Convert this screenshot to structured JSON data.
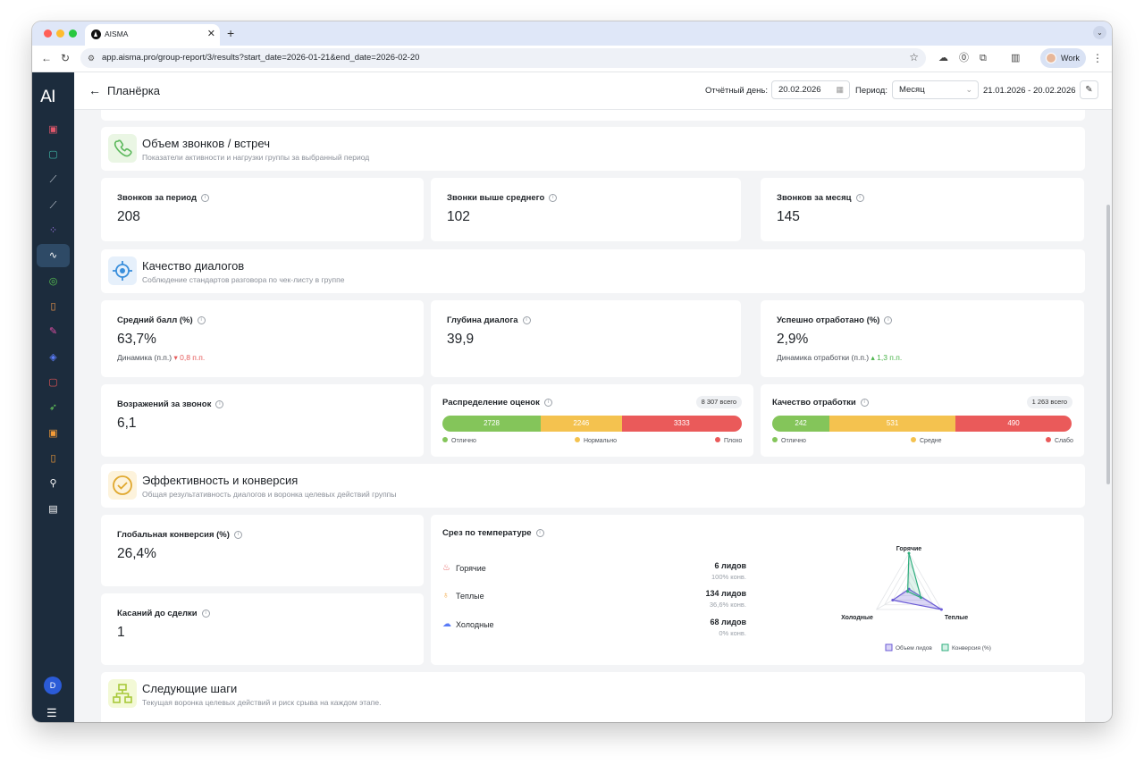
{
  "browser": {
    "tab_title": "AISMA",
    "url": "app.aisma.pro/group-report/3/results?start_date=2026-01-21&end_date=2026-02-20",
    "profile_label": "Work"
  },
  "sidebar": {
    "logo": "AI",
    "user_initial": "D",
    "items": [
      {
        "icon": "report-icon",
        "color": "#e0576b"
      },
      {
        "icon": "chat-icon",
        "color": "#3fb7a6"
      },
      {
        "icon": "line-chart-icon",
        "color": "#c9d1da"
      },
      {
        "icon": "trend-icon",
        "color": "#c9d1da"
      },
      {
        "icon": "apps-icon",
        "color": "#a57cf0"
      },
      {
        "icon": "activity-icon",
        "color": "#ffffff",
        "active": true
      },
      {
        "icon": "target-icon",
        "color": "#57c24f"
      },
      {
        "icon": "clipboard-icon",
        "color": "#f2994a"
      },
      {
        "icon": "edit-icon",
        "color": "#e04fa5"
      },
      {
        "icon": "layers-icon",
        "color": "#5b7cf7"
      },
      {
        "icon": "alert-icon",
        "color": "#e25555"
      },
      {
        "icon": "rocket-icon",
        "color": "#63c75a"
      },
      {
        "icon": "contact-icon",
        "color": "#f29b38"
      },
      {
        "icon": "clipboard-check-icon",
        "color": "#f29b38"
      },
      {
        "icon": "link-icon",
        "color": "#ffffff"
      },
      {
        "icon": "book-icon",
        "color": "#ffffff"
      }
    ]
  },
  "header": {
    "title": "Планёрка",
    "report_day_label": "Отчётный день:",
    "report_day_value": "20.02.2026",
    "period_label": "Период:",
    "period_value": "Месяц",
    "date_range": "21.01.2026 - 20.02.2026"
  },
  "sections": {
    "calls": {
      "title": "Объем звонков / встреч",
      "subtitle": "Показатели активности и нагрузки группы за выбранный период"
    },
    "quality": {
      "title": "Качество диалогов",
      "subtitle": "Соблюдение стандартов разговора по чек-листу в группе"
    },
    "efficiency": {
      "title": "Эффективность и конверсия",
      "subtitle": "Общая результативность диалогов и воронка целевых действий группы"
    },
    "next_steps": {
      "title": "Следующие шаги",
      "subtitle": "Текущая воронка целевых действий и риск срыва на каждом этапе."
    }
  },
  "metrics": {
    "calls_period": {
      "label": "Звонков за период",
      "value": "208"
    },
    "calls_above_avg": {
      "label": "Звонки выше среднего",
      "value": "102"
    },
    "calls_month": {
      "label": "Звонков за месяц",
      "value": "145"
    },
    "avg_score": {
      "label": "Средний балл (%)",
      "value": "63,7%",
      "delta_label": "Динамика (п.п.)",
      "delta_value": "▾ 0,8 п.п."
    },
    "dialog_depth": {
      "label": "Глубина диалога",
      "value": "39,9"
    },
    "handled": {
      "label": "Успешно отработано (%)",
      "value": "2,9%",
      "delta_label": "Динамика отработки (п.п.)",
      "delta_value": "▴ 1,3 п.п."
    },
    "objections": {
      "label": "Возражений за звонок",
      "value": "6,1"
    },
    "global_conversion": {
      "label": "Глобальная конверсия (%)",
      "value": "26,4%"
    },
    "touches": {
      "label": "Касаний до сделки",
      "value": "1"
    }
  },
  "distribution": {
    "title": "Распределение оценок",
    "total": "8 307 всего",
    "segments": [
      {
        "label": "Отлично",
        "value": 2728,
        "color": "#84c55a"
      },
      {
        "label": "Нормально",
        "value": 2246,
        "color": "#f4c24f"
      },
      {
        "label": "Плохо",
        "value": 3333,
        "color": "#ea5a5a"
      }
    ]
  },
  "handling_quality": {
    "title": "Качество отработки",
    "total": "1 263 всего",
    "segments": [
      {
        "label": "Отлично",
        "value": 242,
        "color": "#84c55a"
      },
      {
        "label": "Средне",
        "value": 531,
        "color": "#f4c24f"
      },
      {
        "label": "Слабо",
        "value": 490,
        "color": "#ea5a5a"
      }
    ]
  },
  "temperature": {
    "title": "Срез по температуре",
    "rows": [
      {
        "label": "Горячие",
        "icon": "flame-icon",
        "leads": "6 лидов",
        "conv": "100% конв."
      },
      {
        "label": "Теплые",
        "icon": "thermometer-icon",
        "leads": "134 лидов",
        "conv": "36,6% конв."
      },
      {
        "label": "Холодные",
        "icon": "cloud-icon",
        "leads": "68 лидов",
        "conv": "0% конв."
      }
    ],
    "radar": {
      "axes": [
        "Горячие",
        "Теплые",
        "Холодные"
      ],
      "series": [
        {
          "name": "Объем лидов",
          "values": [
            0.045,
            1.0,
            0.5
          ],
          "color": "#6b5bd6"
        },
        {
          "name": "Конверсия (%)",
          "values": [
            1.0,
            0.37,
            0.0
          ],
          "color": "#2fae7e"
        }
      ]
    }
  }
}
